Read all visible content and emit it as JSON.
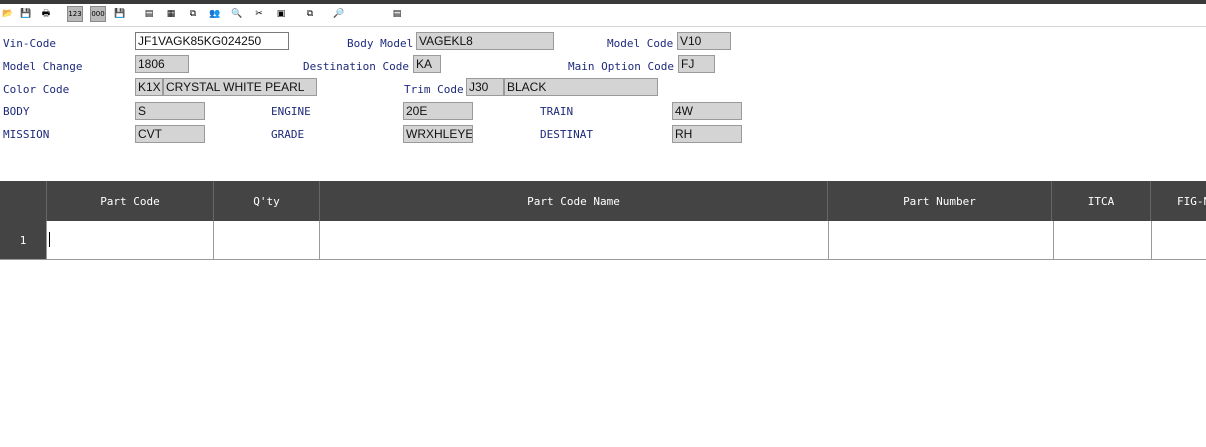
{
  "toolbar": {
    "buttons": [
      {
        "name": "open-icon",
        "glyph": "📂"
      },
      {
        "name": "save-icon",
        "glyph": "💾"
      },
      {
        "name": "print-icon",
        "glyph": "🖶"
      },
      {
        "name": "check-123-icon",
        "glyph": "123"
      },
      {
        "name": "check-000-icon",
        "glyph": "000"
      },
      {
        "name": "save-as-icon",
        "glyph": "💾"
      },
      {
        "name": "document-icon",
        "glyph": "▤"
      },
      {
        "name": "table-icon",
        "glyph": "▦"
      },
      {
        "name": "copy-window-icon",
        "glyph": "⧉"
      },
      {
        "name": "users-icon",
        "glyph": "👥"
      },
      {
        "name": "find-text-icon",
        "glyph": "🔍"
      },
      {
        "name": "tools-icon",
        "glyph": "✂"
      },
      {
        "name": "calendar-icon",
        "glyph": "▣"
      },
      {
        "name": "windows-icon",
        "glyph": "⧉"
      },
      {
        "name": "zoom-doc-icon",
        "glyph": "🔎"
      },
      {
        "name": "export-icon",
        "glyph": "▤"
      }
    ]
  },
  "header": {
    "vin_code": {
      "label": "Vin-Code",
      "value": "JF1VAGK85KG024250"
    },
    "body_model": {
      "label": "Body Model",
      "value": "VAGEKL8"
    },
    "model_code": {
      "label": "Model Code",
      "value": "V10"
    },
    "model_change": {
      "label": "Model Change",
      "value": "1806"
    },
    "destination_code": {
      "label": "Destination Code",
      "value": "KA"
    },
    "main_option_code": {
      "label": "Main Option Code",
      "value": "FJ"
    },
    "color_code": {
      "label": "Color Code",
      "code": "K1X",
      "name": "CRYSTAL WHITE PEARL"
    },
    "trim_code": {
      "label": "Trim Code",
      "code": "J30",
      "name": "BLACK"
    },
    "body": {
      "label": "BODY",
      "value": "S"
    },
    "engine": {
      "label": "ENGINE",
      "value": "20E"
    },
    "train": {
      "label": "TRAIN",
      "value": "4W"
    },
    "mission": {
      "label": "MISSION",
      "value": "CVT"
    },
    "grade": {
      "label": "GRADE",
      "value": "WRXHLEYE"
    },
    "destinat": {
      "label": "DESTINAT",
      "value": "RH"
    }
  },
  "grid": {
    "columns": [
      "Part Code",
      "Q'ty",
      "Part Code Name",
      "Part Number",
      "ITCA",
      "FIG-N"
    ],
    "rows": [
      {
        "num": "1",
        "cells": [
          "",
          "",
          "",
          "",
          "",
          ""
        ]
      }
    ]
  }
}
